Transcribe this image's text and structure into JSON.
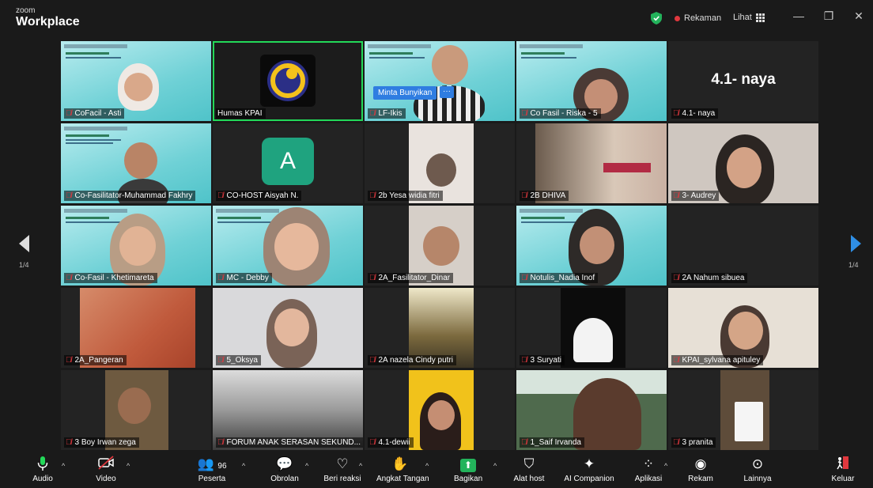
{
  "app": {
    "brand_small": "zoom",
    "brand_big": "Workplace"
  },
  "titlebar": {
    "recording": "Rekaman",
    "view": "Lihat",
    "minimize": "—",
    "restore": "❐",
    "close": "✕"
  },
  "gallery": {
    "page_left": "1/4",
    "page_right": "1/4",
    "unmute_request": "Minta Bunyikan",
    "more": "···",
    "big_name": "4.1- naya",
    "avatar_letter": "A",
    "tiles": [
      "CoFacil - Asti",
      "Humas KPAI",
      "LF-Ikis",
      "Co Fasil - Riska - 5",
      "4.1- naya",
      "Co-Fasilitator-Muhammad Fakhry",
      "CO-HOST Aisyah N.",
      "2b Yesa widia fitri",
      "2B DHIVA",
      "3- Audrey",
      "Co-Fasil - Khetimareta",
      "MC - Debby",
      "2A_Fasilitator_Dinar",
      "Notulis_Nadia Inof",
      "2A Nahum sibuea",
      "2A_Pangeran",
      "5_Oksya",
      "2A nazela Cindy putri",
      "3 Suryati",
      "KPAI_sylvana apituley",
      "3 Boy Irwan zega",
      "FORUM ANAK SERASAN SEKUND...",
      "4.1-dewii",
      "1_Saif Irvanda",
      "3 pranita"
    ]
  },
  "toolbar": {
    "audio": "Audio",
    "video": "Video",
    "participants": "Peserta",
    "participants_count": "96",
    "chat": "Obrolan",
    "react": "Beri reaksi",
    "raise_hand": "Angkat Tangan",
    "share": "Bagikan",
    "host_tools": "Alat host",
    "ai_companion": "AI Companion",
    "apps": "Aplikasi",
    "record": "Rekam",
    "more": "Lainnya",
    "leave": "Keluar"
  },
  "colors": {
    "accent_green": "#23d959",
    "share_green": "#23b35b",
    "leave_red": "#e0383e",
    "blue": "#2f7de1"
  }
}
